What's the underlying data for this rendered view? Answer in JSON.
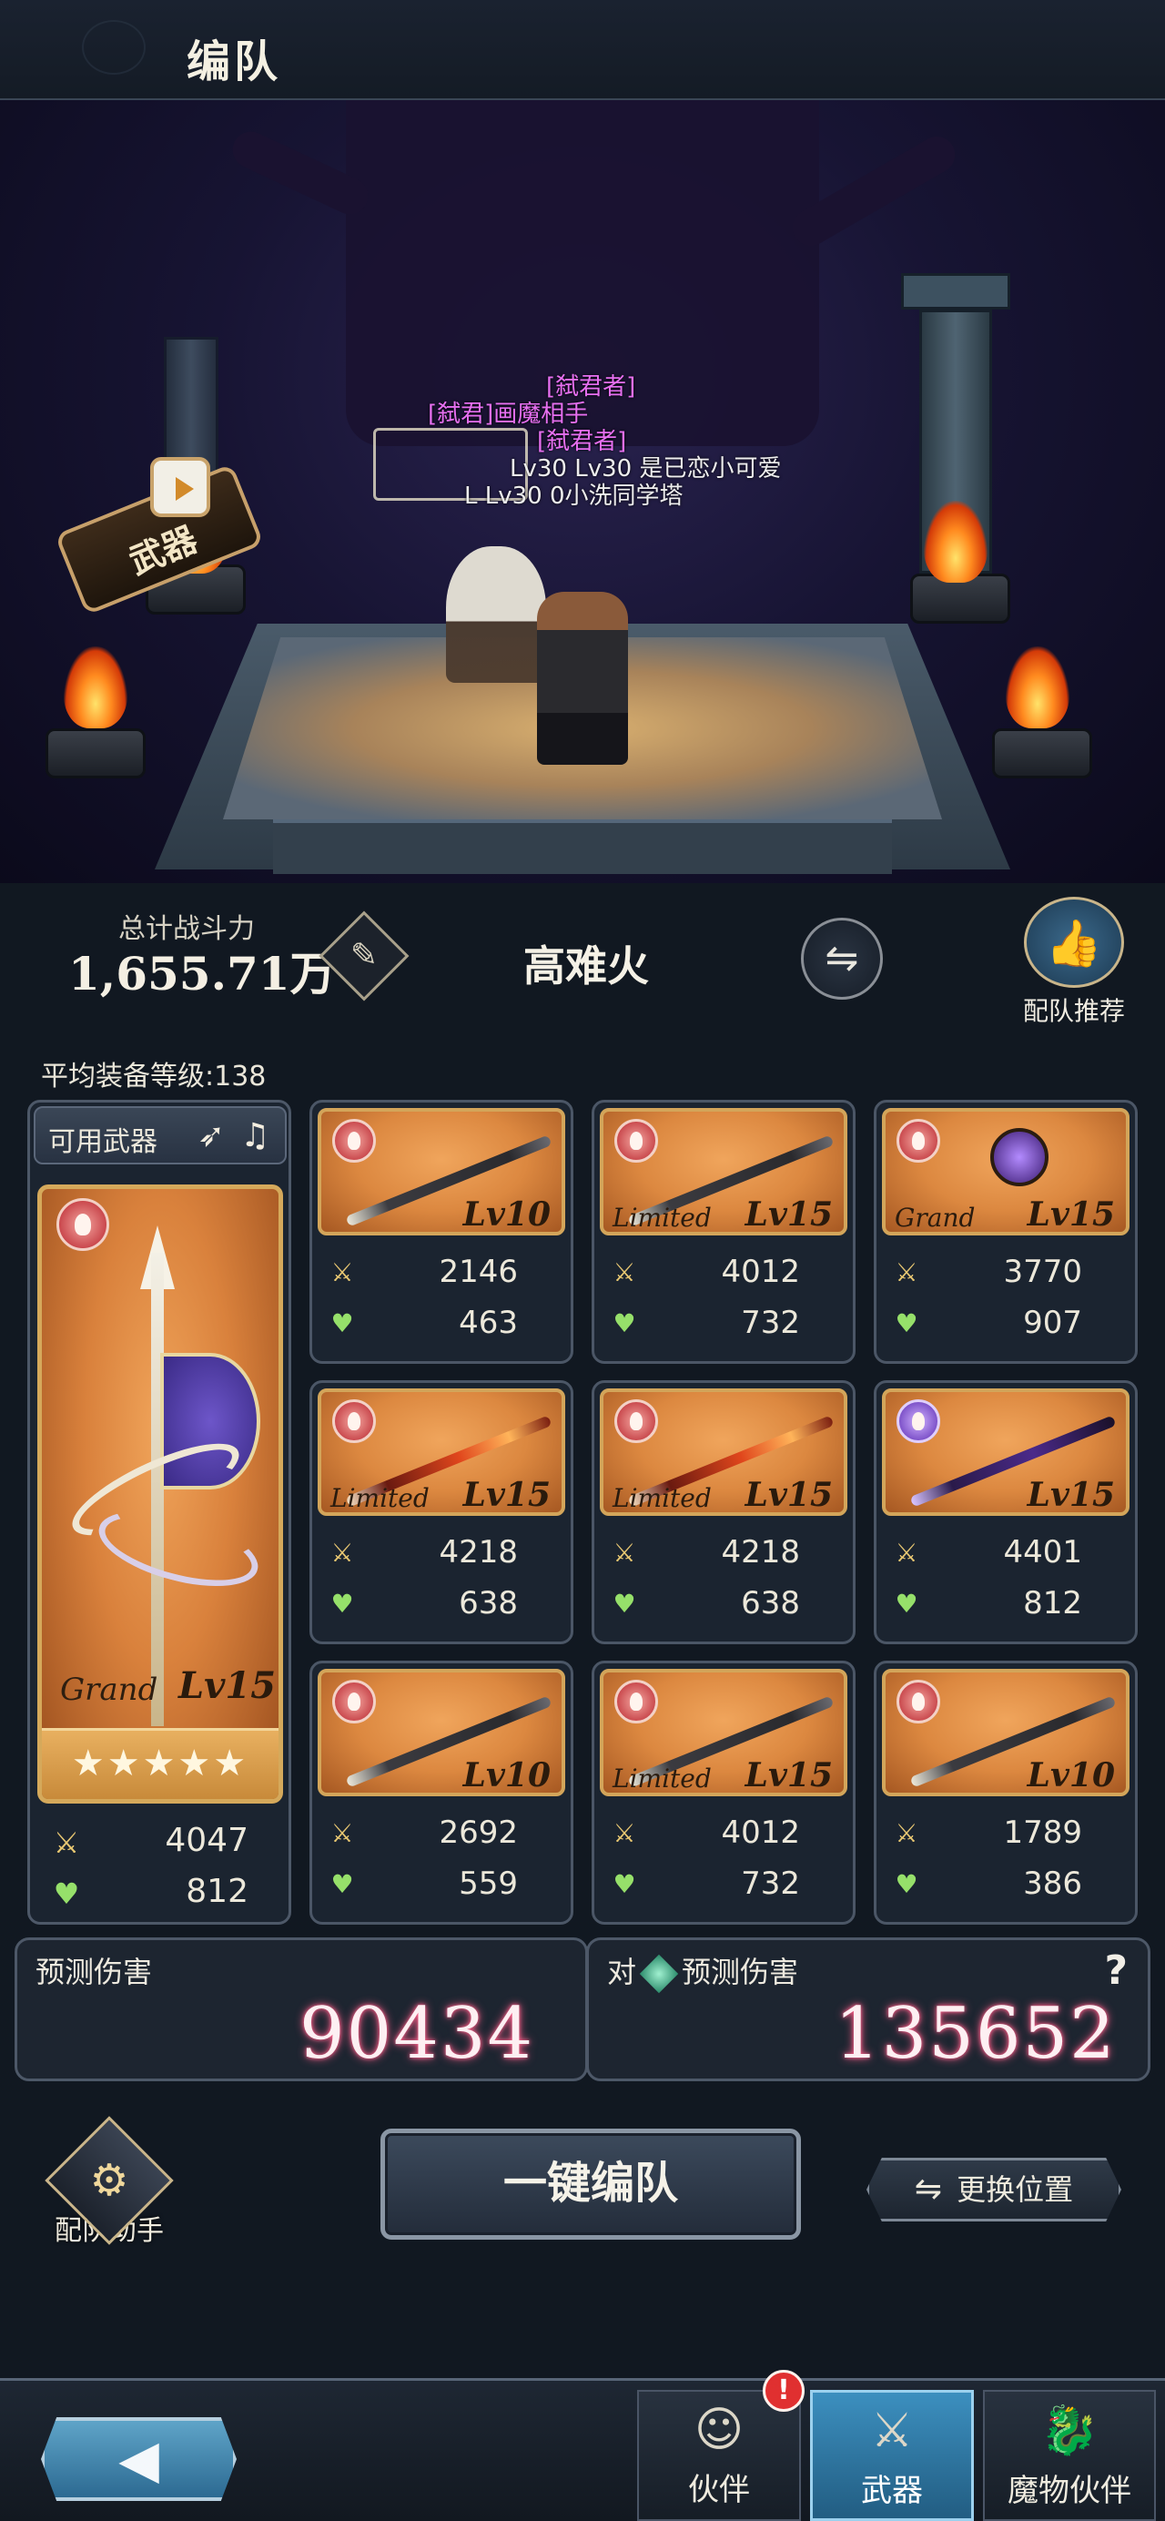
{
  "header": {
    "title": "编队"
  },
  "scene": {
    "weapon_badge": "武器",
    "nameplates": {
      "line1": "[弑君者]",
      "line2": "[弑君]画魔相手",
      "line3": "[弑君者]",
      "line4": "Lv30  Lv30   是已恋小可爱",
      "line5": "L  Lv30  0小洗同学塔"
    }
  },
  "power": {
    "label": "总计战斗力",
    "value": "1,655.71万"
  },
  "team": {
    "name": "高难火",
    "swap_icon": "⇋"
  },
  "recommend": {
    "label": "配队推荐",
    "icon": "thumbs-up-icon"
  },
  "avg_level": "平均装备等级:138",
  "available": {
    "label": "可用武器",
    "icon1": "spear-icon",
    "icon2": "harp-icon"
  },
  "main_weapon": {
    "rarity": "Grand",
    "level": "Lv15",
    "stars": "★★★★★",
    "atk": "4047",
    "hp": "812"
  },
  "weapons": [
    {
      "rarity": "",
      "level": "Lv10",
      "atk": "2146",
      "hp": "463"
    },
    {
      "rarity": "Limited",
      "level": "Lv15",
      "atk": "4012",
      "hp": "732"
    },
    {
      "rarity": "Grand",
      "level": "Lv15",
      "atk": "3770",
      "hp": "907"
    },
    {
      "rarity": "Limited",
      "level": "Lv15",
      "atk": "4218",
      "hp": "638"
    },
    {
      "rarity": "Limited",
      "level": "Lv15",
      "atk": "4218",
      "hp": "638"
    },
    {
      "rarity": "",
      "level": "Lv15",
      "atk": "4401",
      "hp": "812"
    },
    {
      "rarity": "",
      "level": "Lv10",
      "atk": "2692",
      "hp": "559"
    },
    {
      "rarity": "Limited",
      "level": "Lv15",
      "atk": "4012",
      "hp": "732"
    },
    {
      "rarity": "",
      "level": "Lv10",
      "atk": "1789",
      "hp": "386"
    }
  ],
  "damage": {
    "left_label": "预测伤害",
    "left_value": "90434",
    "right_prefix": "对",
    "right_label": "预测伤害",
    "right_value": "135652",
    "help": "?"
  },
  "actions": {
    "assist_label": "配队助手",
    "auto_label": "一键编队",
    "position_label": "更换位置",
    "position_icon": "⇋"
  },
  "nav": {
    "back_icon": "◀",
    "tabs": [
      {
        "label": "伙伴",
        "icon": "companion-icon"
      },
      {
        "label": "武器",
        "icon": "weapon-icon"
      },
      {
        "label": "魔物伙伴",
        "icon": "monster-icon"
      }
    ],
    "notice": "!"
  },
  "colors": {
    "accent_gold": "#d3a55a",
    "fire_card": "#dc8840",
    "active_tab": "#3c8fbf",
    "damage_glow": "#ff5f8a"
  }
}
